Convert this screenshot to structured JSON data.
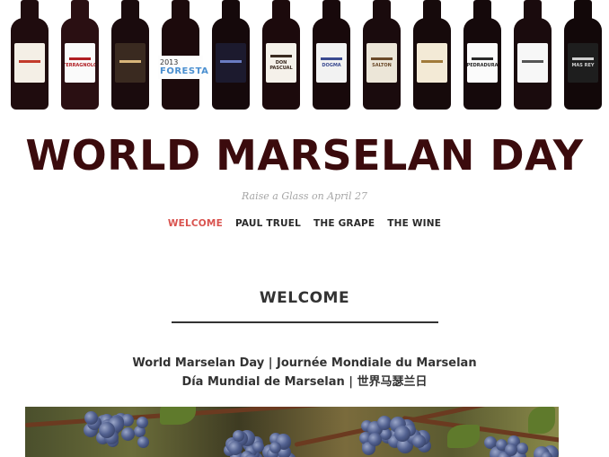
{
  "bottles": [
    {
      "name": "bottle-1",
      "glass": "#1f0c0e",
      "label_bg": "#f4efe6",
      "accent": "#c23a2b",
      "text": ""
    },
    {
      "name": "bottle-terragnolo",
      "glass": "#2a0f12",
      "label_bg": "#fafafa",
      "accent": "#b01e23",
      "text": "TERRAGNOLO"
    },
    {
      "name": "bottle-3",
      "glass": "#1a0b0d",
      "label_bg": "#3a2a20",
      "accent": "#d8b57a",
      "text": ""
    },
    {
      "name": "bottle-foresta",
      "glass": "#1c0a0c",
      "label_bg": "#fdfdfd",
      "accent": "#4a8fd0",
      "text": "FORESTA",
      "year": "2013"
    },
    {
      "name": "bottle-5",
      "glass": "#15090b",
      "label_bg": "#1c1a2e",
      "accent": "#6a7cc2",
      "text": ""
    },
    {
      "name": "bottle-don-pascual",
      "glass": "#1c0a0c",
      "label_bg": "#f5f1ea",
      "accent": "#3a2a20",
      "text": "DON PASCUAL"
    },
    {
      "name": "bottle-dogma",
      "glass": "#18090b",
      "label_bg": "#f2f2f2",
      "accent": "#3a4a90",
      "text": "DOGMA"
    },
    {
      "name": "bottle-salton",
      "glass": "#1a0b0d",
      "label_bg": "#ece6d8",
      "accent": "#6b4a2a",
      "text": "SALTON"
    },
    {
      "name": "bottle-9",
      "glass": "#160a0b",
      "label_bg": "#f3ead6",
      "accent": "#a07a3a",
      "text": ""
    },
    {
      "name": "bottle-pedradura",
      "glass": "#15090b",
      "label_bg": "#fbfbfb",
      "accent": "#2a2a2a",
      "text": "PEDRADURA"
    },
    {
      "name": "bottle-11",
      "glass": "#1a0b0d",
      "label_bg": "#f7f7f7",
      "accent": "#555555",
      "text": ""
    },
    {
      "name": "bottle-mas-rey",
      "glass": "#120809",
      "label_bg": "#1e1e1e",
      "accent": "#cfcfcf",
      "text": "MAS REY"
    }
  ],
  "site": {
    "title": "WORLD MARSELAN DAY",
    "tagline": "Raise a Glass on April 27"
  },
  "nav": {
    "items": [
      {
        "label": "WELCOME",
        "active": true
      },
      {
        "label": "PAUL TRUEL",
        "active": false
      },
      {
        "label": "THE GRAPE",
        "active": false
      },
      {
        "label": "THE WINE",
        "active": false
      }
    ]
  },
  "welcome": {
    "heading": "WELCOME",
    "line1": "World Marselan Day | Journée Mondiale du Marselan",
    "line2": "Día Mundial de Marselan | 世界马瑟兰日"
  },
  "colors": {
    "title": "#3b0b0d",
    "nav_active": "#d9534f",
    "tagline": "#a6a6a6"
  }
}
